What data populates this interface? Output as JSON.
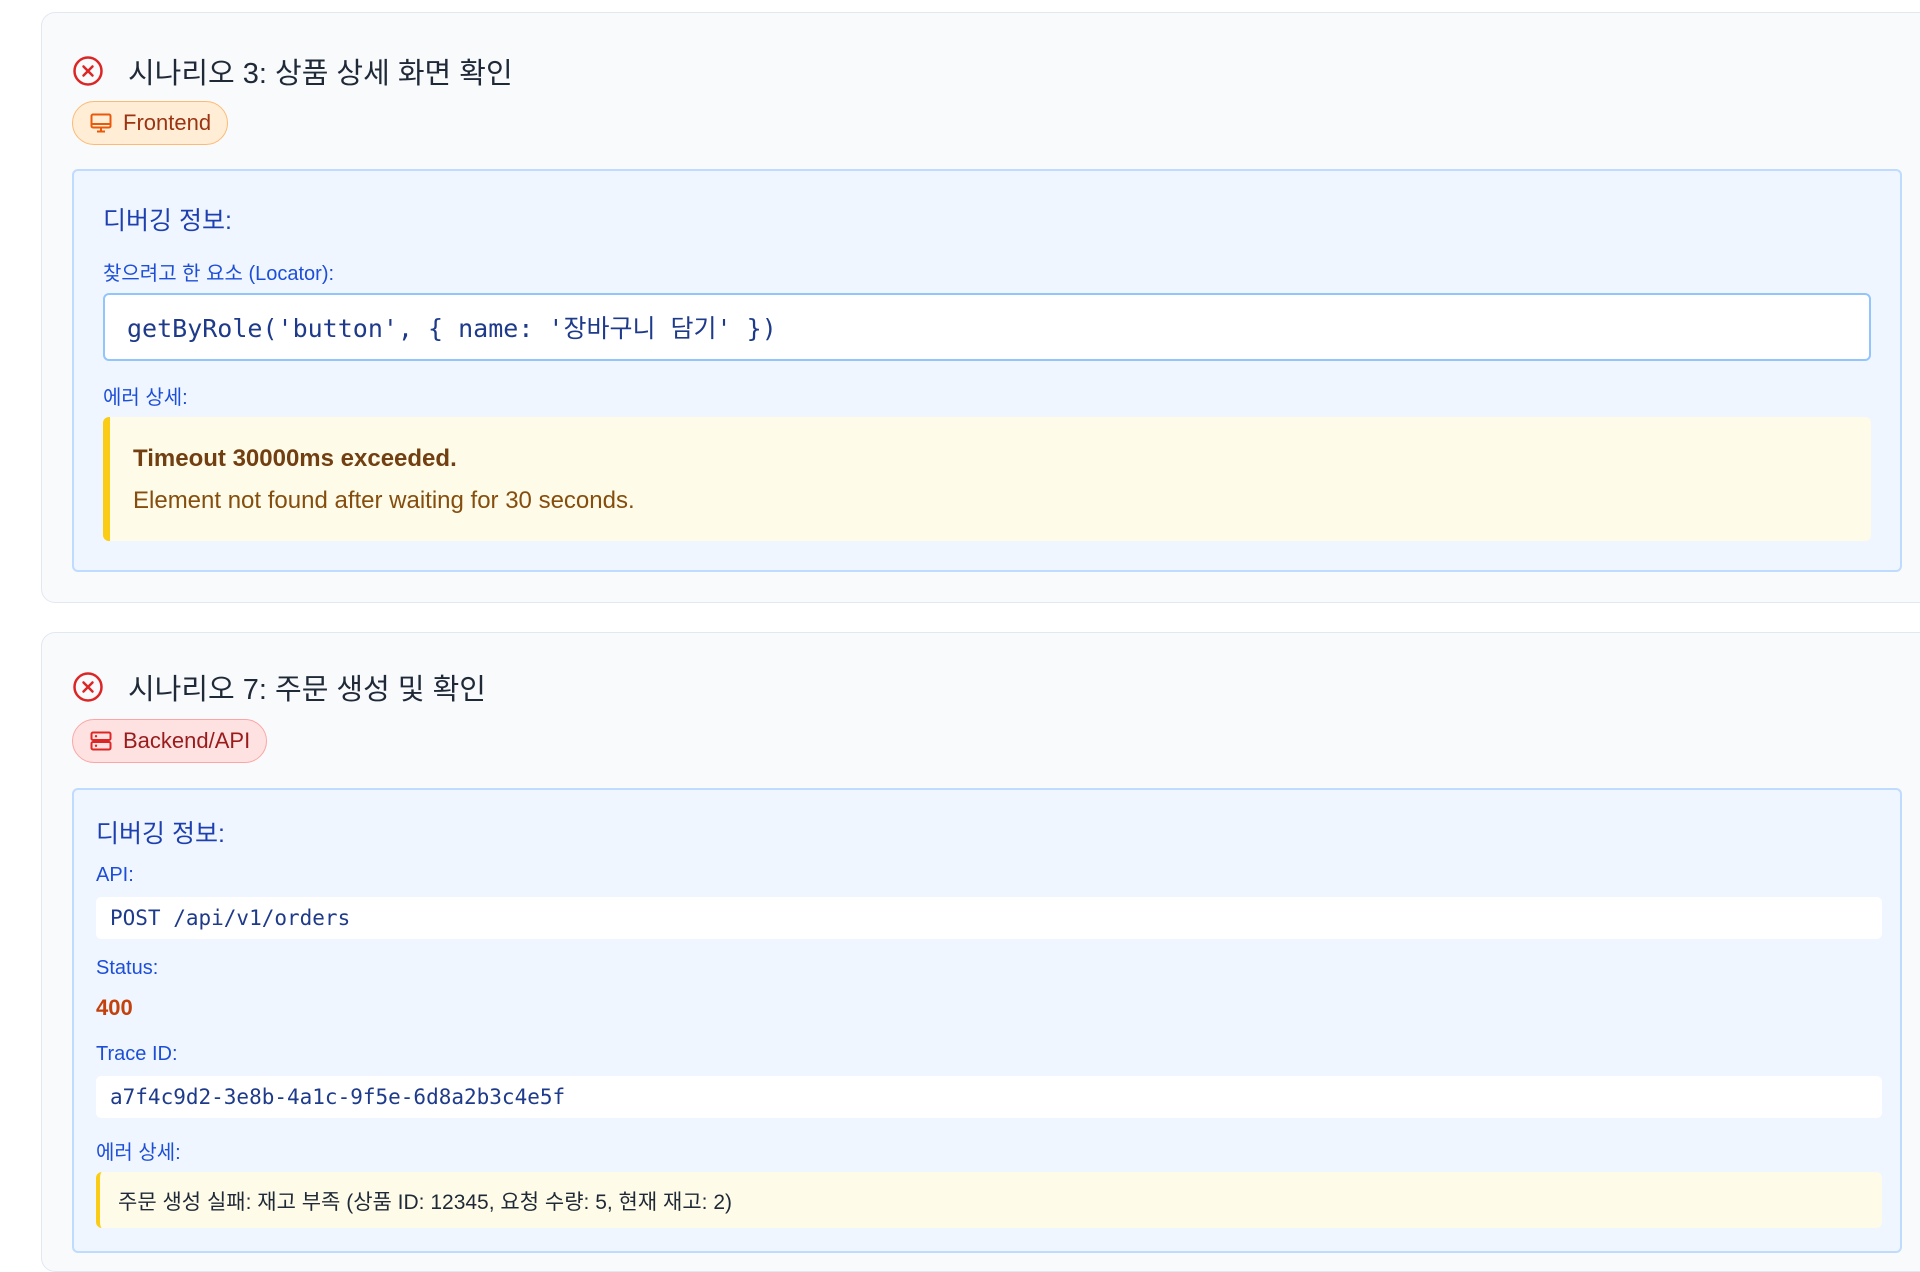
{
  "scenario3": {
    "title": "시나리오 3: 상품 상세 화면 확인",
    "badge": "Frontend",
    "debug_title": "디버깅 정보:",
    "locator_label": "찾으려고 한 요소 (Locator):",
    "locator_value": "getByRole('button', { name: '장바구니 담기' })",
    "error_label": "에러 상세:",
    "error_title": "Timeout 30000ms exceeded.",
    "error_message": "Element not found after waiting for 30 seconds."
  },
  "scenario7": {
    "title": "시나리오 7: 주문 생성 및 확인",
    "badge": "Backend/API",
    "debug_title": "디버깅 정보:",
    "api_label": "API:",
    "api_value": "POST /api/v1/orders",
    "status_label": "Status:",
    "status_value": "400",
    "trace_label": "Trace ID:",
    "trace_value": "a7f4c9d2-3e8b-4a1c-9f5e-6d8a2b3c4e5f",
    "error_label": "에러 상세:",
    "error_message": "주문 생성 실패: 재고 부족 (상품 ID: 12345, 요청 수량: 5, 현재 재고: 2)"
  },
  "colors": {
    "fail": "#dc2626",
    "frontend_badge": "#ffedd5",
    "backend_badge": "#fee2e2",
    "status_error": "#c2410c",
    "warning_border": "#facc15"
  },
  "icons": {
    "fail": "x-circle-icon",
    "frontend": "monitor-icon",
    "backend": "server-icon"
  }
}
